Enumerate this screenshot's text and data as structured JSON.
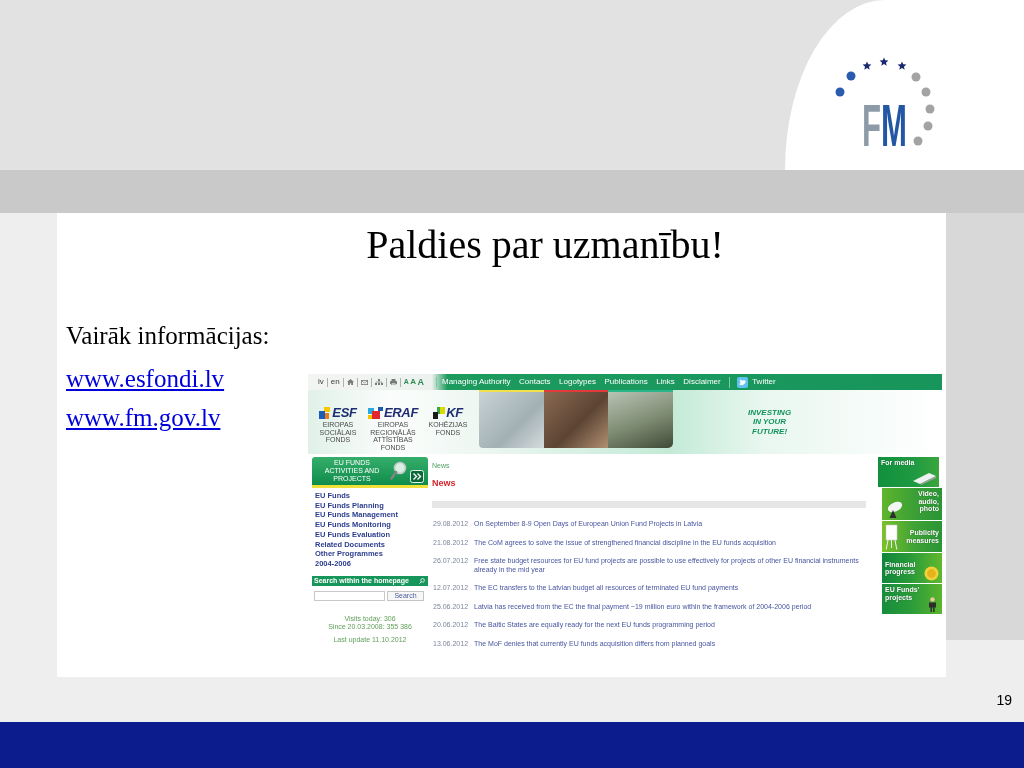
{
  "slide": {
    "title": "Paldies par uzmanību!",
    "subtitle": "Vairāk informācijas:",
    "links": [
      "www.esfondi.lv",
      "www.fm.gov.lv"
    ],
    "page_number": "19"
  },
  "logo": {
    "monogram": "FM"
  },
  "website": {
    "topbar": {
      "languages": [
        "lv",
        "en"
      ],
      "font_sizes": [
        "A",
        "A",
        "A"
      ],
      "menu": [
        "Managing Authority",
        "Contacts",
        "Logotypes",
        "Publications",
        "Links",
        "Disclaimer"
      ],
      "twitter": "Twitter"
    },
    "fund_logos": [
      {
        "name": "ESF",
        "caption": "EIROPAS SOCIĀLAIS FONDS"
      },
      {
        "name": "ERAF",
        "caption": "EIROPAS REĢIONĀLĀS ATTĪSTĪBAS FONDS"
      },
      {
        "name": "KF",
        "caption": "KOHĒZIJAS FONDS"
      }
    ],
    "photos": [
      {
        "color": "#f2e04a"
      },
      {
        "color": "#e23a3a"
      },
      {
        "color": "#2bb58a"
      }
    ],
    "tagline": "INVESTING IN YOUR FUTURE!",
    "sidebar": {
      "banner": "EU FUNDS ACTIVITIES AND PROJECTS",
      "items": [
        "EU Funds",
        "EU Funds Planning",
        "EU Funds Management",
        "EU Funds Monitoring",
        "EU Funds Evaluation",
        "Related Documents",
        "Other Programmes",
        "2004-2006"
      ],
      "search": {
        "title": "Search within the homepage",
        "button": "Search"
      },
      "stats": [
        "Visits today: 306",
        "Since 20.03.2008: 355 386"
      ],
      "last_update": "Last update 11.10.2012"
    },
    "content": {
      "breadcrumb": "News",
      "heading": "News",
      "news": [
        {
          "date": "29.08.2012",
          "title": "On September 8-9 Open Days of European Union Fund Projects in Latvia"
        },
        {
          "date": "21.08.2012",
          "title": "The CoM agrees to solve the issue of strengthened financial discipline in the EU funds acquisition"
        },
        {
          "date": "26.07.2012",
          "title": "Free state budget resources for EU fund projects are possible to use effectively for projects of other EU financial instruments already in the mid year"
        },
        {
          "date": "12.07.2012",
          "title": "The EC transfers to the Latvian budget all resources of terminated EU fund payments"
        },
        {
          "date": "25.06.2012",
          "title": "Latvia has received from the EC the final payment ~19 million euro within the framework of 2004-2006 period"
        },
        {
          "date": "20.06.2012",
          "title": "The Baltic States are equally ready for the next EU funds programming period"
        },
        {
          "date": "13.06.2012",
          "title": "The MoF denies that currently EU funds acquisition differs from planned goals"
        }
      ]
    },
    "tiles": [
      "For media",
      "Video, audio, photo",
      "Publicity measures",
      "Financial progress",
      "EU Funds' projects"
    ]
  }
}
